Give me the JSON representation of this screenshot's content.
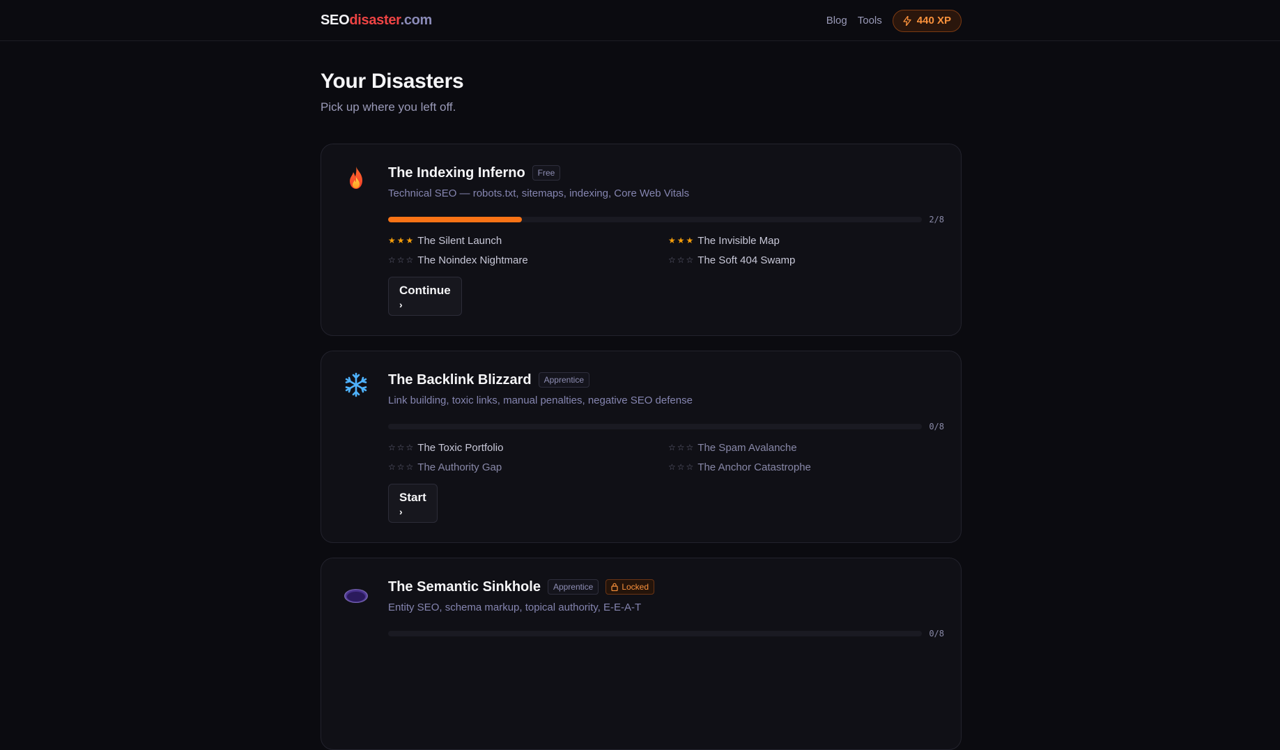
{
  "header": {
    "logo": {
      "part1": "SEO",
      "part2": "disaster",
      "part3": ".com"
    },
    "nav": [
      {
        "label": "Blog"
      },
      {
        "label": "Tools"
      }
    ],
    "xp": {
      "label": "440 XP",
      "icon": "lightning-icon"
    }
  },
  "page": {
    "title": "Your Disasters",
    "subtitle": "Pick up where you left off."
  },
  "colors": {
    "accent_orange": "#f97316",
    "star_filled": "#f59e0b",
    "brand_red": "#ef4444"
  },
  "cards": [
    {
      "icon": "fire-icon",
      "title": "The Indexing Inferno",
      "tier": "Free",
      "locked": false,
      "description": "Technical SEO — robots.txt, sitemaps, indexing, Core Web Vitals",
      "progress": {
        "completed": 2,
        "total": 8,
        "label": "2/8"
      },
      "levels": [
        {
          "name": "The Silent Launch",
          "stars": 3
        },
        {
          "name": "The Invisible Map",
          "stars": 3
        },
        {
          "name": "The Noindex Nightmare",
          "stars": 0
        },
        {
          "name": "The Soft 404 Swamp",
          "stars": 0
        }
      ],
      "action": "Continue"
    },
    {
      "icon": "snowflake-icon",
      "title": "The Backlink Blizzard",
      "tier": "Apprentice",
      "locked": false,
      "description": "Link building, toxic links, manual penalties, negative SEO defense",
      "progress": {
        "completed": 0,
        "total": 8,
        "label": "0/8"
      },
      "levels": [
        {
          "name": "The Toxic Portfolio",
          "stars": 0
        },
        {
          "name": "The Spam Avalanche",
          "stars": 0
        },
        {
          "name": "The Authority Gap",
          "stars": 0
        },
        {
          "name": "The Anchor Catastrophe",
          "stars": 0
        }
      ],
      "action": "Start"
    },
    {
      "icon": "sinkhole-icon",
      "title": "The Semantic Sinkhole",
      "tier": "Apprentice",
      "locked": true,
      "lock_label": "Locked",
      "description": "Entity SEO, schema markup, topical authority, E-E-A-T",
      "progress": {
        "completed": 0,
        "total": 8,
        "label": "0/8"
      },
      "levels": [],
      "action": ""
    }
  ]
}
